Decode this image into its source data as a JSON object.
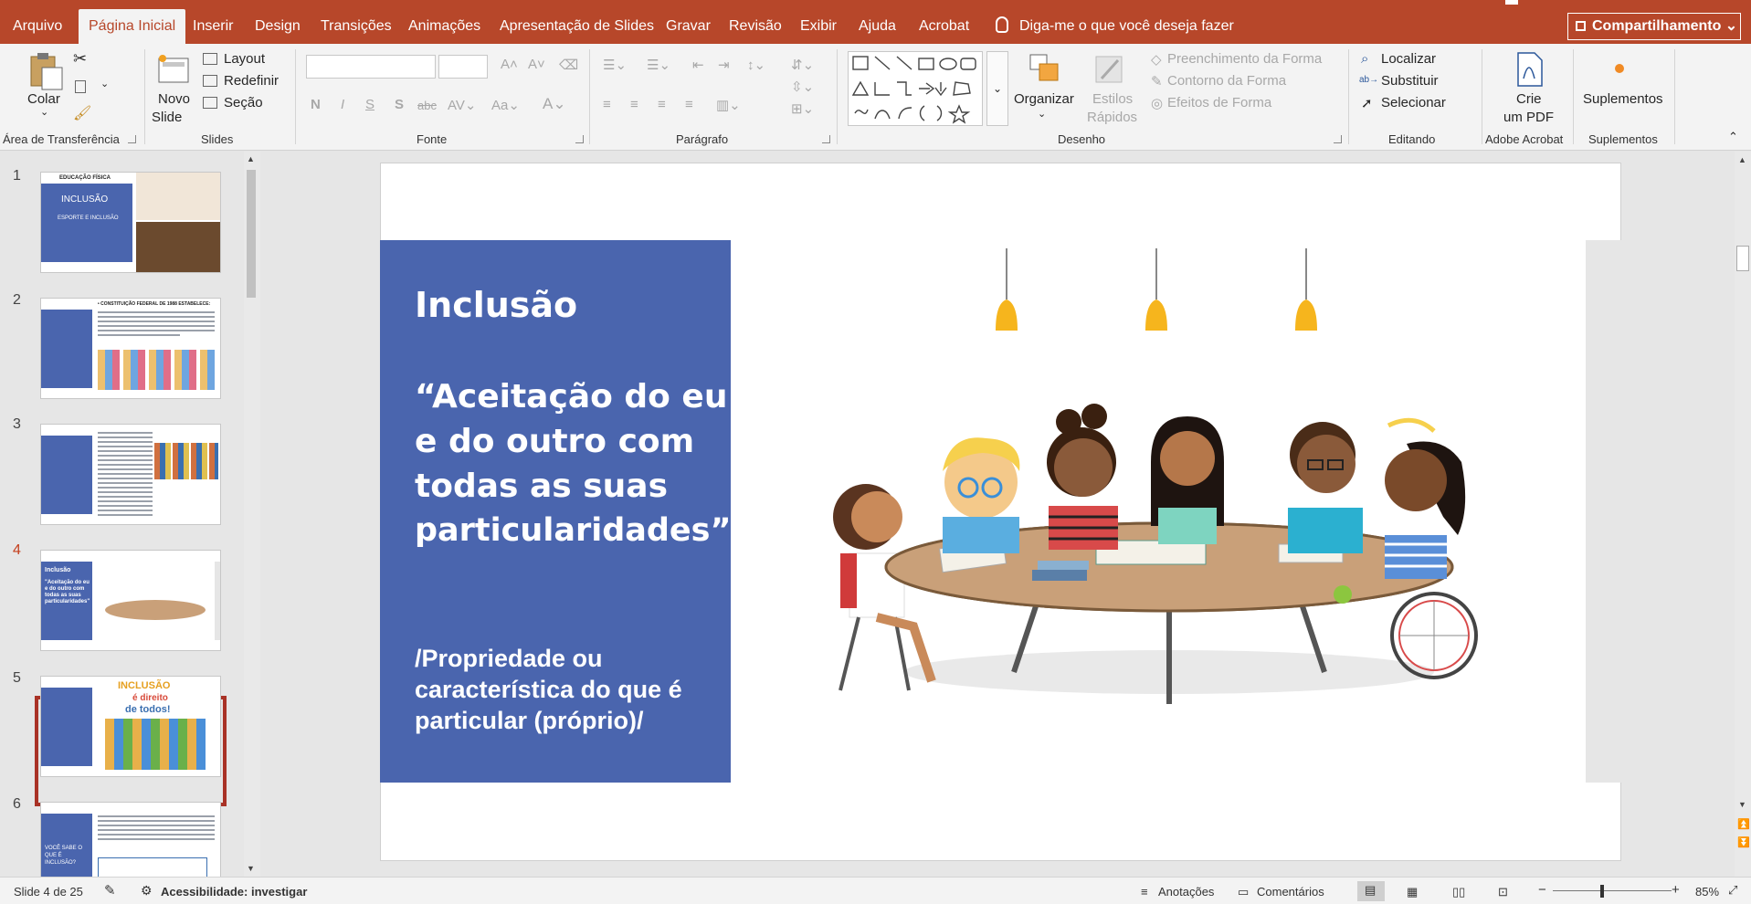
{
  "tabs": [
    "Arquivo",
    "Página Inicial",
    "Inserir",
    "Design",
    "Transições",
    "Animações",
    "Apresentação de Slides",
    "Gravar",
    "Revisão",
    "Exibir",
    "Ajuda",
    "Acrobat"
  ],
  "active_tab": "Página Inicial",
  "tell_me": "Diga-me o que você deseja fazer",
  "share": "Compartilhamento",
  "ribbon": {
    "clipboard": {
      "paste": "Colar",
      "label": "Área de Transferência"
    },
    "slides": {
      "new_slide_line1": "Novo",
      "new_slide_line2": "Slide",
      "layout": "Layout",
      "reset": "Redefinir",
      "section": "Seção",
      "label": "Slides"
    },
    "font": {
      "label": "Fonte"
    },
    "paragraph": {
      "label": "Parágrafo"
    },
    "drawing": {
      "arrange": "Organizar",
      "quick_styles_line1": "Estilos",
      "quick_styles_line2": "Rápidos",
      "fill": "Preenchimento da Forma",
      "outline": "Contorno da Forma",
      "effects": "Efeitos de Forma",
      "label": "Desenho"
    },
    "editing": {
      "find": "Localizar",
      "replace": "Substituir",
      "select": "Selecionar",
      "label": "Editando"
    },
    "acrobat": {
      "create_line1": "Crie",
      "create_line2": "um PDF",
      "label": "Adobe Acrobat"
    },
    "addins": {
      "addins": "Suplementos",
      "label": "Suplementos"
    }
  },
  "thumbnails": [
    {
      "num": "1",
      "title": "INCLUSÃO",
      "subtitle": "ESPORTE E INCLUSÃO",
      "header": "EDUCAÇÃO FÍSICA"
    },
    {
      "num": "2",
      "header": "• CONSTITUIÇÃO FEDERAL DE 1988 ESTABELECE:"
    },
    {
      "num": "3"
    },
    {
      "num": "4",
      "title": "Inclusão",
      "quote": "\"Aceitação do eu e do outro com todas as suas particularidades\""
    },
    {
      "num": "5",
      "title": "INCLUSÃO",
      "line2": "é direito",
      "line3": "de todos!"
    },
    {
      "num": "6",
      "title": "VOCÊ SABE O QUE É INCLUSÃO?"
    }
  ],
  "active_slide": "4",
  "slide": {
    "title": "Inclusão",
    "quote_lines": [
      "“Aceitação do eu",
      "e do outro com",
      "todas as suas",
      "particularidades”"
    ],
    "note_lines": [
      "/Propriedade ou",
      "característica do que é",
      "particular (próprio)/"
    ]
  },
  "status": {
    "slide_count": "Slide 4 de 25",
    "accessibility": "Acessibilidade: investigar",
    "notes": "Anotações",
    "comments": "Comentários",
    "zoom": "85%"
  },
  "colors": {
    "accent": "#b7472a",
    "slide_blue": "#4a65ae",
    "selection": "#a93226"
  }
}
